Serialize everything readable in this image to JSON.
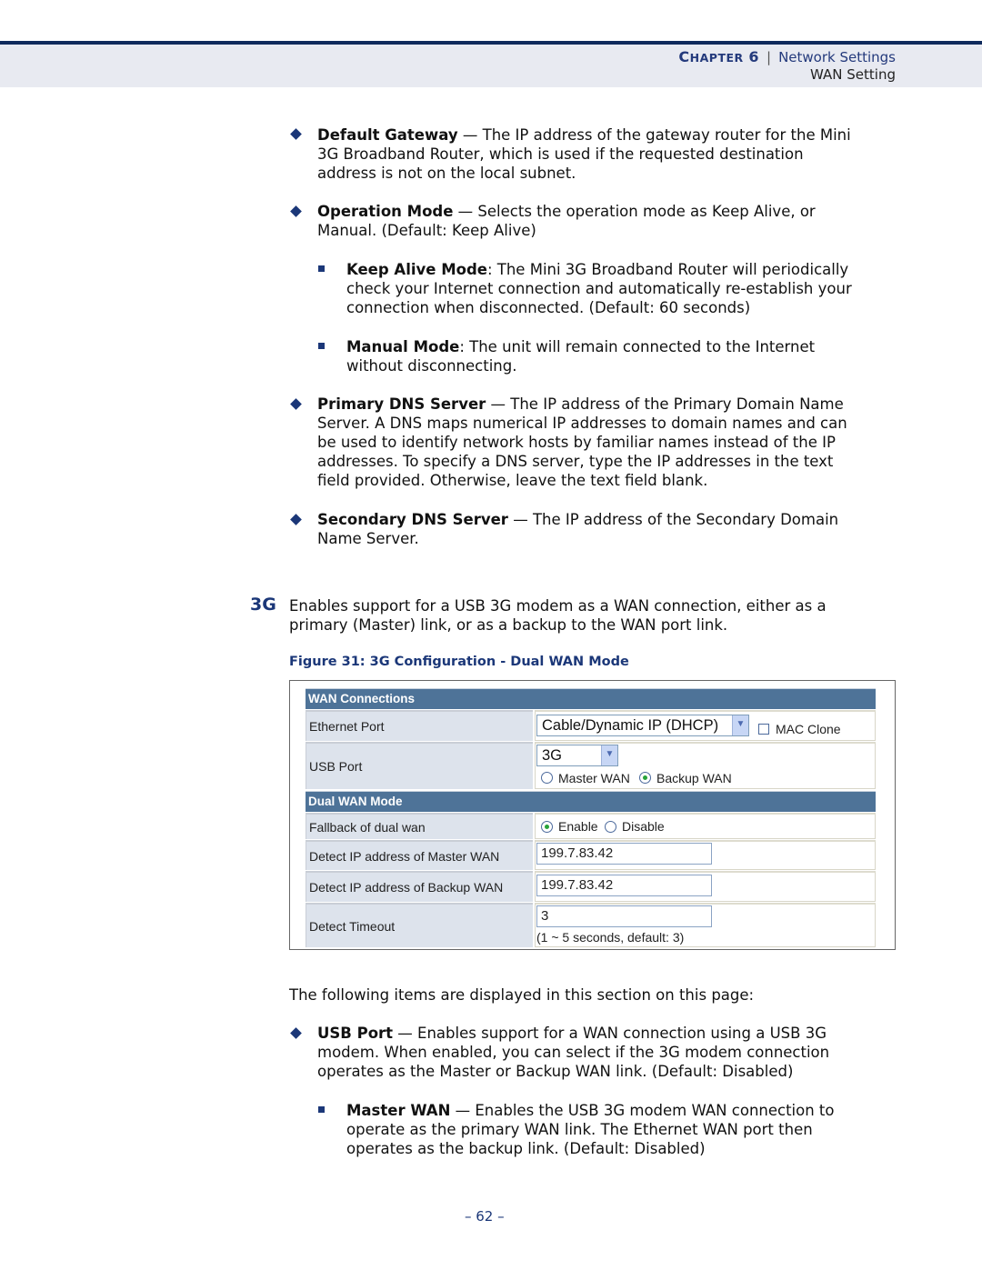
{
  "header": {
    "chapter_prefix": "C",
    "chapter_word": "HAPTER",
    "chapter_num": "6",
    "separator": "|",
    "section": "Network Settings",
    "subsection": "WAN Setting"
  },
  "bullets_top": [
    {
      "term": "Default Gateway",
      "lines": [
        " — The IP address of the gateway router for the Mini",
        "3G Broadband Router, which is used if the requested destination",
        "address is not on the local subnet."
      ]
    },
    {
      "term": "Operation Mode",
      "lines": [
        " — Selects the operation mode as Keep Alive, or",
        "Manual. (Default: Keep Alive)"
      ]
    },
    {
      "term": "Primary DNS Server",
      "lines": [
        " — The IP address of the Primary Domain Name",
        "Server. A DNS maps numerical IP addresses to domain names and can",
        "be used to identify network hosts by familiar names instead of the IP",
        "addresses. To specify a DNS server, type the IP addresses in the text",
        "field provided. Otherwise, leave the text field blank."
      ]
    },
    {
      "term": "Secondary DNS Server",
      "lines": [
        " — The IP address of the Secondary Domain",
        "Name Server."
      ]
    }
  ],
  "sub_bullets_top": [
    {
      "term": "Keep Alive Mode",
      "lines": [
        ": The Mini 3G Broadband Router will periodically",
        "check your Internet connection and automatically re-establish your",
        "connection when disconnected. (Default: 60 seconds)"
      ]
    },
    {
      "term": "Manual Mode",
      "lines": [
        ": The unit will remain connected to the Internet",
        "without disconnecting."
      ]
    }
  ],
  "section_3g": {
    "label": "3G",
    "lines": [
      "Enables support for a USB 3G modem as a WAN connection, either as a",
      "primary (Master) link, or as a backup to the WAN port link."
    ]
  },
  "figure": {
    "caption": "Figure 31:  3G Configuration - Dual WAN Mode",
    "wan_connections_header": "WAN Connections",
    "ethernet_port_label": "Ethernet Port",
    "ethernet_port_select": "Cable/Dynamic IP (DHCP)",
    "mac_clone_label": "MAC Clone",
    "mac_clone_checked": false,
    "usb_port_label": "USB Port",
    "usb_port_select": "3G",
    "master_wan_label": "Master WAN",
    "backup_wan_label": "Backup WAN",
    "usb_mode_selected": "Backup WAN",
    "dual_wan_header": "Dual WAN Mode",
    "fallback_label": "Fallback of dual wan",
    "enable_label": "Enable",
    "disable_label": "Disable",
    "fallback_selected": "Enable",
    "detect_master_label": "Detect IP address of Master WAN",
    "detect_master_value": "199.7.83.42",
    "detect_backup_label": "Detect IP address of Backup WAN",
    "detect_backup_value": "199.7.83.42",
    "detect_timeout_label": "Detect Timeout",
    "detect_timeout_value": "3",
    "detect_timeout_hint": "(1 ~ 5 seconds, default: 3)"
  },
  "following": "The following items are displayed in this section on this page:",
  "bullets_bottom": [
    {
      "term": "USB Port",
      "lines": [
        " — Enables support for a WAN connection using a USB 3G",
        "modem. When enabled, you can select if the 3G modem connection",
        "operates as the Master or Backup WAN link. (Default: Disabled)"
      ]
    }
  ],
  "sub_bullets_bottom": [
    {
      "term": "Master WAN",
      "lines": [
        " — Enables the USB 3G modem WAN connection to",
        "operate as the primary WAN link. The Ethernet WAN port then",
        "operates as the backup link. (Default: Disabled)"
      ]
    }
  ],
  "page_number": "–  62  –"
}
